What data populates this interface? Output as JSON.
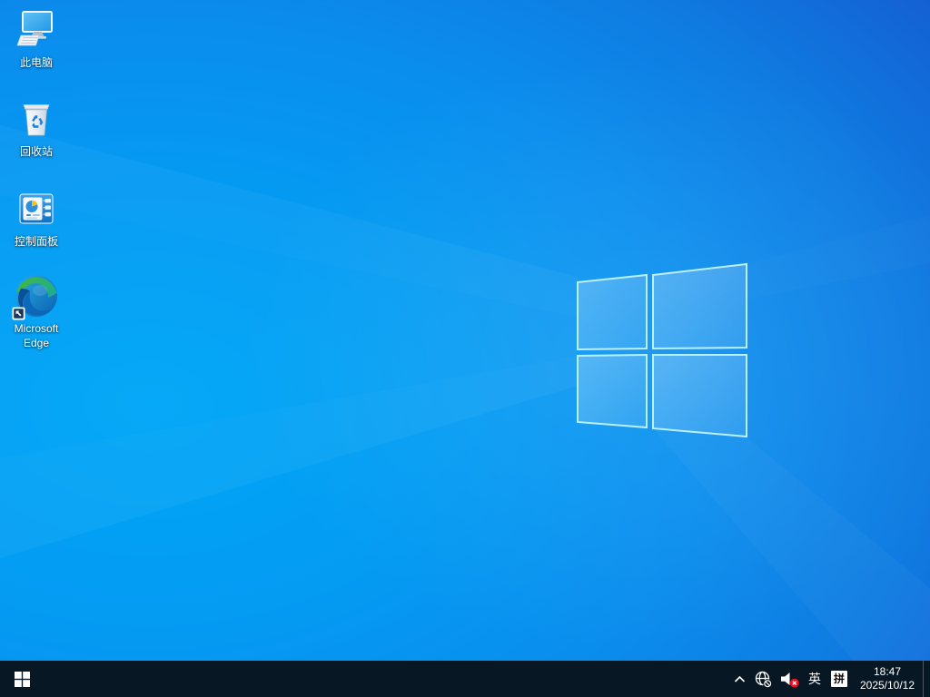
{
  "wallpaper": {
    "description": "windows-10-light-logo-wallpaper",
    "logo_icon": "windows-logo"
  },
  "desktop": {
    "icons": [
      {
        "id": "this-pc",
        "icon": "computer-icon",
        "label": "此电脑"
      },
      {
        "id": "recycle-bin",
        "icon": "recycle-bin-icon",
        "label": "回收站"
      },
      {
        "id": "control-panel",
        "icon": "control-panel-icon",
        "label": "控制面板"
      },
      {
        "id": "microsoft-edge",
        "icon": "edge-browser-icon",
        "label": "Microsoft Edge"
      }
    ]
  },
  "taskbar": {
    "start": {
      "icon": "windows-start-icon"
    },
    "tray": {
      "chevron_icon": "chevron-up-icon",
      "network_icon": "globe-no-internet-icon",
      "volume_icon": "speaker-muted-icon",
      "language": "英",
      "ime": "拼",
      "clock": {
        "time": "18:47",
        "date": "2025/10/12"
      }
    }
  },
  "colors": {
    "taskbar_bg": "#081724",
    "wallpaper_bright": "#00a7f7",
    "wallpaper_deep": "#1a46c0",
    "pane_border": "#c2f4ff",
    "volume_badge": "#e81123",
    "label_text": "#ffffff"
  }
}
